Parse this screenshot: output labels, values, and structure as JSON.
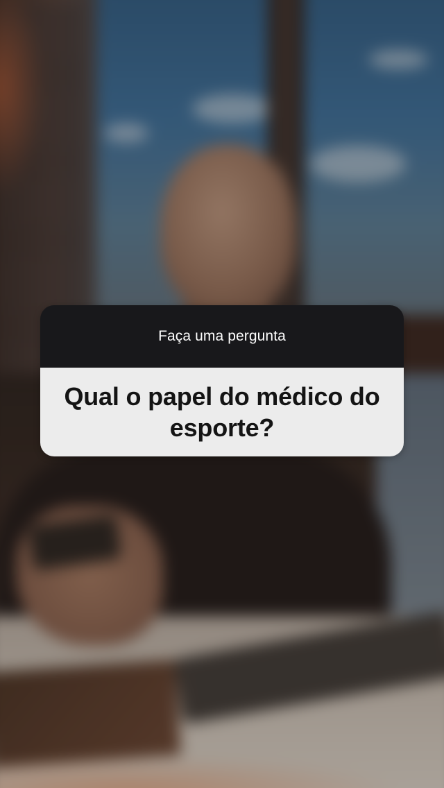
{
  "story": {
    "background_description_icon": "photo-background-icon",
    "question_sticker": {
      "prompt": "Faça uma pergunta",
      "answer": "Qual o papel do médico do esporte?",
      "header_color": "#18181b",
      "body_color": "#ececec"
    }
  }
}
